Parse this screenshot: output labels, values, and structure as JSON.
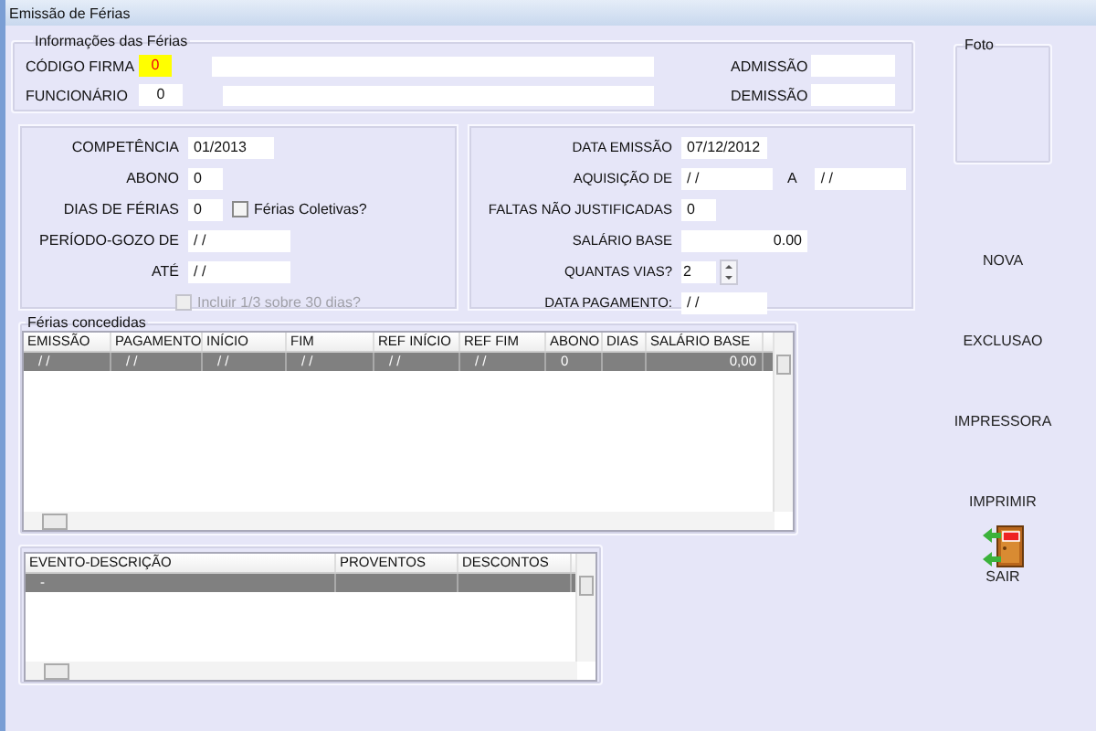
{
  "window": {
    "title": "Emissão de Férias"
  },
  "info": {
    "legend": "Informações das Férias",
    "rows": [
      {
        "label": "CÓDIGO FIRMA",
        "code": "0",
        "highlighted": true,
        "date_label": "ADMISSÃO"
      },
      {
        "label": "FUNCIONÁRIO",
        "code": "0",
        "highlighted": false,
        "date_label": "DEMISSÃO"
      }
    ]
  },
  "photo": {
    "legend": "Foto"
  },
  "left_panel": {
    "fields": [
      {
        "kind": "date",
        "label": "COMPETÊNCIA",
        "value": "01/2013"
      },
      {
        "kind": "short",
        "label": "ABONO",
        "value": "0"
      },
      {
        "kind": "check",
        "label": "DIAS DE FÉRIAS",
        "value": "0",
        "check_label": "Férias Coletivas?",
        "checked": false
      },
      {
        "kind": "wide",
        "label": "PERÍODO-GOZO DE",
        "value": "/ /"
      },
      {
        "kind": "wide",
        "label": "ATÉ",
        "value": "/ /"
      }
    ],
    "option": {
      "label": "Incluir 1/3 sobre 30 dias?",
      "checked": false,
      "disabled": true
    }
  },
  "right_panel": {
    "fields": [
      {
        "kind": "date",
        "label": "DATA EMISSÃO",
        "value": "07/12/2012"
      },
      {
        "kind": "range",
        "label": "AQUISIÇÃO DE",
        "value": "/ /",
        "to_label": "A",
        "value_to": "/ /"
      },
      {
        "kind": "short",
        "label": "FALTAS NÃO JUSTIFICADAS",
        "value": "0"
      },
      {
        "kind": "number",
        "label": "SALÁRIO BASE",
        "value": "0.00"
      },
      {
        "kind": "spin",
        "label": "QUANTAS VIAS?",
        "value": "2"
      },
      {
        "kind": "date",
        "label": "DATA PAGAMENTO:",
        "value": "/ /"
      }
    ]
  },
  "granted": {
    "legend": "Férias concedidas",
    "columns": [
      "EMISSÃO",
      "PAGAMENTO",
      "INÍCIO",
      "FIM",
      "REF INÍCIO",
      "REF FIM",
      "ABONO",
      "DIAS",
      "SALÁRIO BASE"
    ],
    "rows": [
      {
        "cells": [
          "/ /",
          "/ /",
          "/ /",
          "/ /",
          "/ /",
          "/ /",
          "0",
          "",
          "0,00"
        ],
        "selected": true
      }
    ]
  },
  "events": {
    "columns": [
      "EVENTO-DESCRIÇÃO",
      "PROVENTOS",
      "DESCONTOS"
    ],
    "rows": [
      {
        "cells": [
          "-",
          "",
          ""
        ],
        "selected": true
      }
    ]
  },
  "actions": [
    "NOVA",
    "EXCLUSAO",
    "IMPRESSORA",
    "IMPRIMIR"
  ],
  "exit": {
    "label": "SAIR"
  }
}
